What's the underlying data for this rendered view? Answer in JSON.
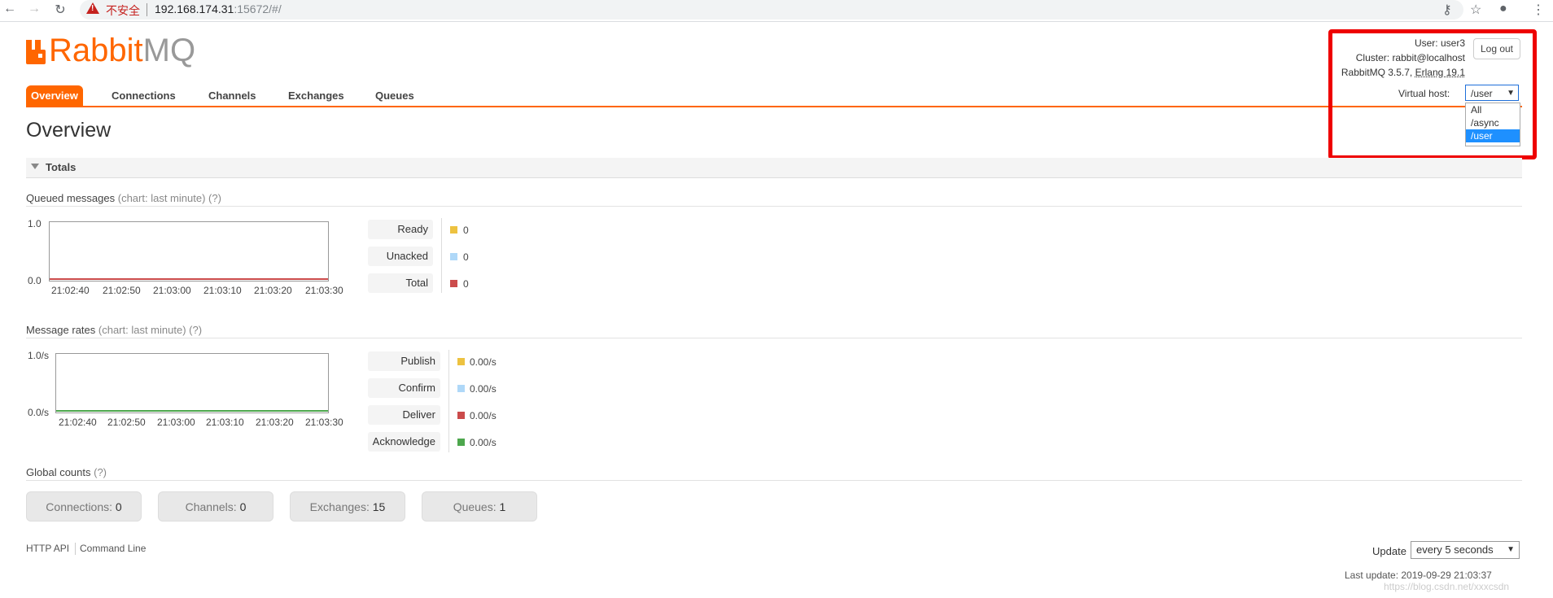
{
  "browser": {
    "security_label": "不安全",
    "url_host": "192.168.174.31",
    "url_rest": ":15672/#/"
  },
  "logo": {
    "rabbit": "Rabbit",
    "mq": "MQ"
  },
  "tabs": [
    "Overview",
    "Connections",
    "Channels",
    "Exchanges",
    "Queues"
  ],
  "user": {
    "user_label": "User: ",
    "user": "user3",
    "cluster_label": "Cluster: ",
    "cluster": "rabbit@localhost",
    "version": "RabbitMQ 3.5.7, ",
    "erlang": "Erlang 19.1",
    "logout": "Log out"
  },
  "vhost": {
    "label": "Virtual host:",
    "selected": "/user",
    "options": [
      "All",
      "/async",
      "/user"
    ]
  },
  "page_title": "Overview",
  "totals_label": "Totals",
  "queued": {
    "title": "Queued messages",
    "hint": "(chart: last minute) (?)",
    "y_top": "1.0",
    "y_bottom": "0.0",
    "x_ticks": [
      "21:02:40",
      "21:02:50",
      "21:03:00",
      "21:03:10",
      "21:03:20",
      "21:03:30"
    ],
    "legend": [
      {
        "label": "Ready",
        "value": "0",
        "color": "#edc240"
      },
      {
        "label": "Unacked",
        "value": "0",
        "color": "#afd8f8"
      },
      {
        "label": "Total",
        "value": "0",
        "color": "#cb4b4b"
      }
    ]
  },
  "rates": {
    "title": "Message rates",
    "hint": "(chart: last minute) (?)",
    "y_top": "1.0/s",
    "y_bottom": "0.0/s",
    "x_ticks": [
      "21:02:40",
      "21:02:50",
      "21:03:00",
      "21:03:10",
      "21:03:20",
      "21:03:30"
    ],
    "legend": [
      {
        "label": "Publish",
        "value": "0.00/s",
        "color": "#edc240"
      },
      {
        "label": "Confirm",
        "value": "0.00/s",
        "color": "#afd8f8"
      },
      {
        "label": "Deliver",
        "value": "0.00/s",
        "color": "#cb4b4b"
      },
      {
        "label": "Acknowledge",
        "value": "0.00/s",
        "color": "#4da74d"
      }
    ]
  },
  "global": {
    "title": "Global counts",
    "hint": "(?)",
    "counts": [
      {
        "label": "Connections: ",
        "value": "0"
      },
      {
        "label": "Channels: ",
        "value": "0"
      },
      {
        "label": "Exchanges: ",
        "value": "15"
      },
      {
        "label": "Queues: ",
        "value": "1"
      }
    ]
  },
  "footer": {
    "http_api": "HTTP API",
    "command_line": "Command Line",
    "update_label": "Update",
    "update_value": "every 5 seconds",
    "last_update": "Last update: 2019-09-29 21:03:37",
    "watermark": "https://blog.csdn.net/xxxcsdn"
  }
}
